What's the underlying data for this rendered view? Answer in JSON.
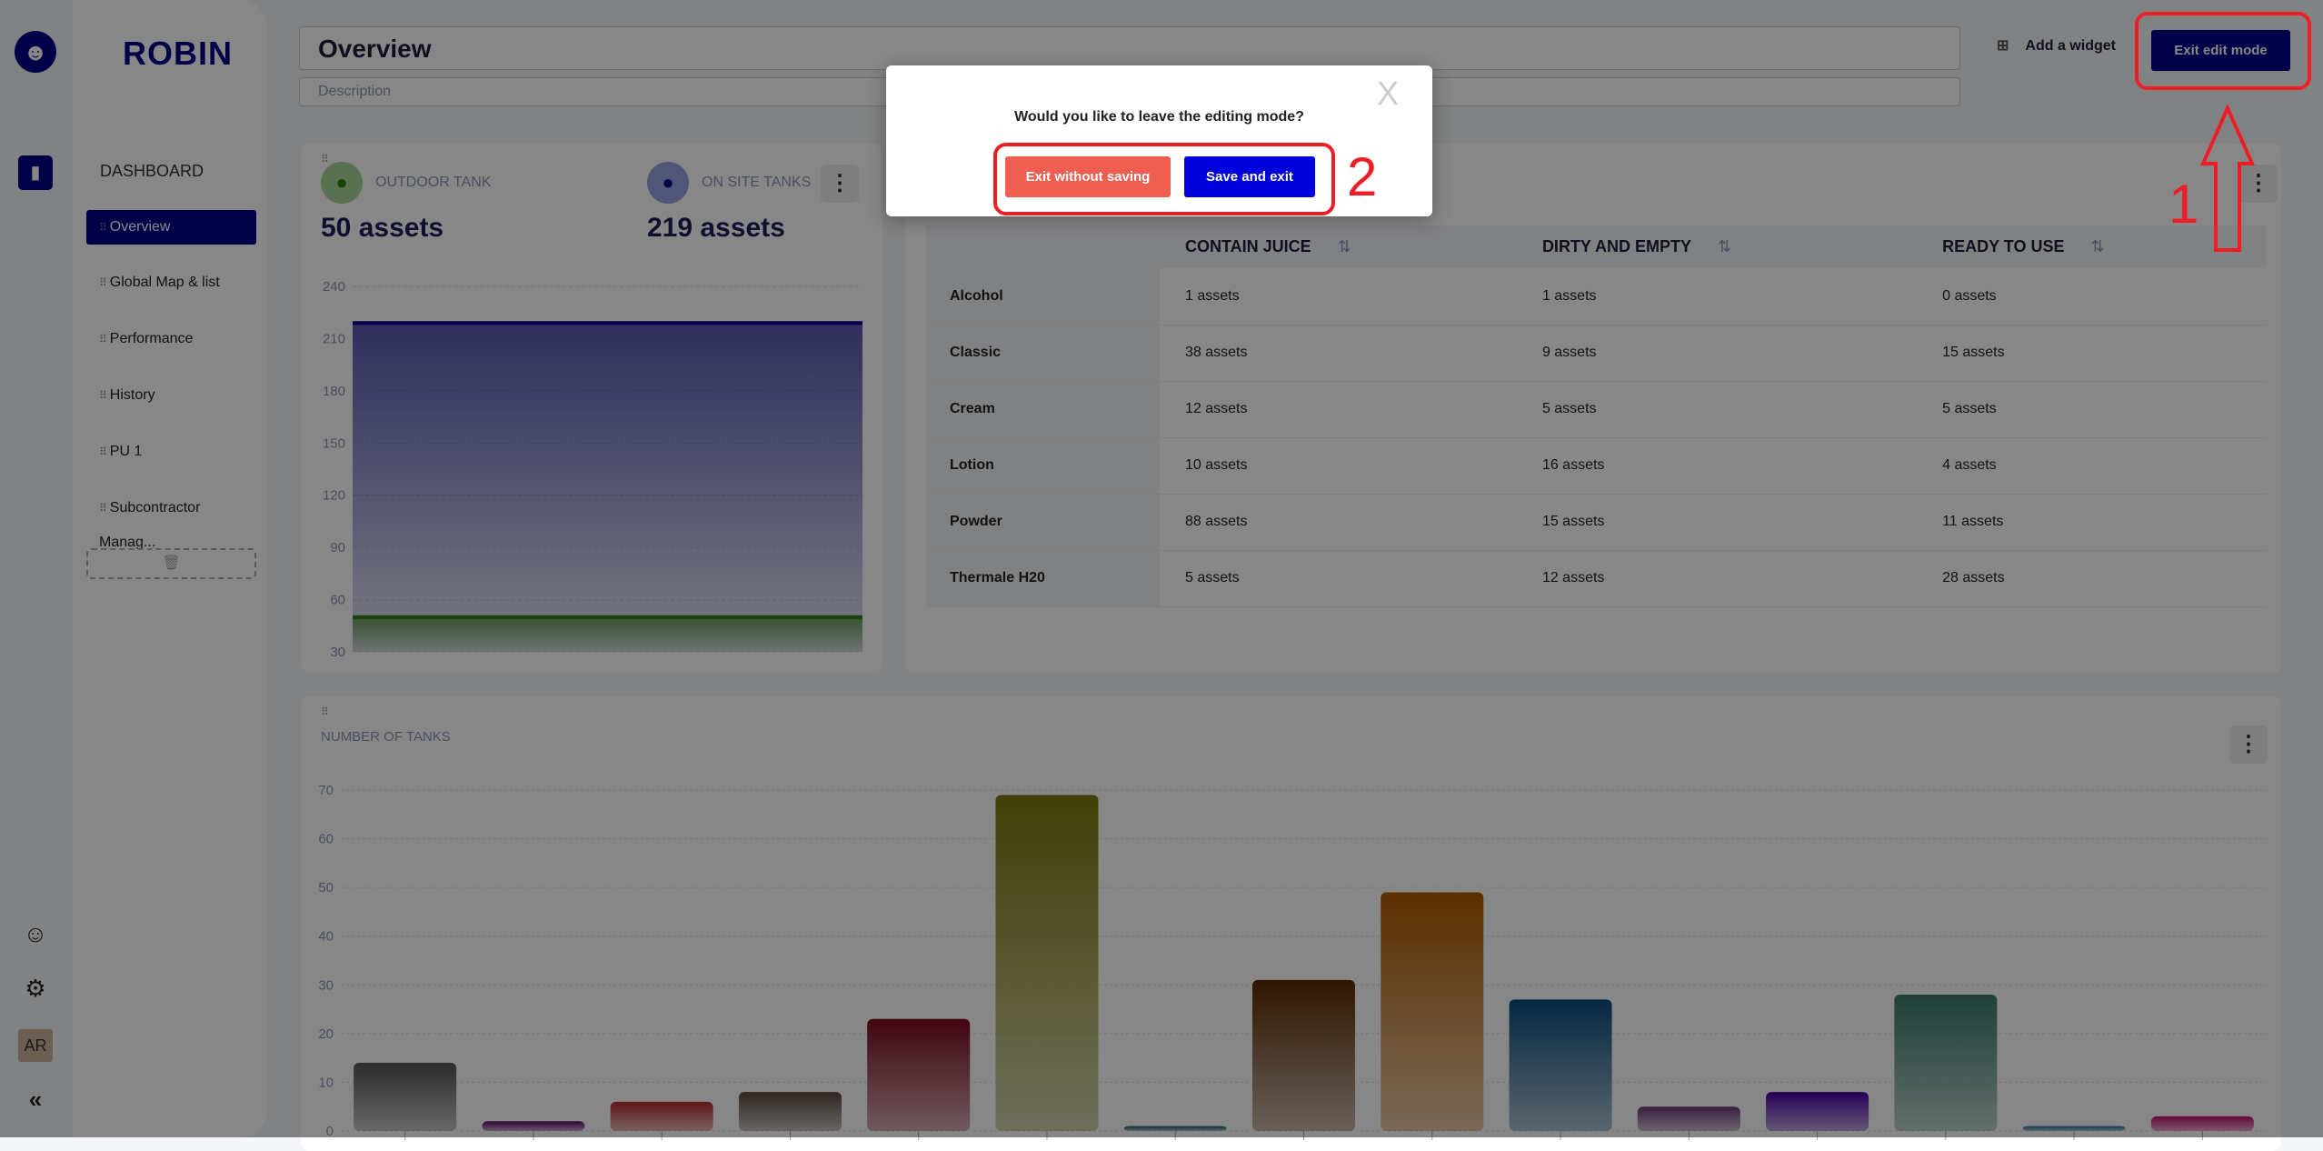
{
  "app": {
    "brand": "ROBIN",
    "logo_icon": "robin-bird-icon"
  },
  "rail": {
    "icons": [
      "folder-icon",
      "support-icon",
      "gear-icon"
    ],
    "avatar": "AR",
    "collapse": "«"
  },
  "sidebar": {
    "section": "DASHBOARD",
    "items": [
      {
        "label": "Overview",
        "active": true
      },
      {
        "label": "Global Map & list"
      },
      {
        "label": "Performance"
      },
      {
        "label": "History"
      },
      {
        "label": "PU 1"
      },
      {
        "label": "Subcontractor Manag..."
      }
    ],
    "trash_icon": "trash-icon"
  },
  "header": {
    "title": "Overview",
    "description_placeholder": "Description",
    "add_widget": "Add a widget",
    "exit_edit": "Exit edit mode"
  },
  "kpis": [
    {
      "label": "OUTDOOR TANK",
      "value": "50 assets",
      "color": "#2e7d0f"
    },
    {
      "label": "ON SITE TANKS",
      "value": "219 assets",
      "color": "#00008a"
    }
  ],
  "table": {
    "columns": [
      "",
      "CONTAIN JUICE",
      "DIRTY AND EMPTY",
      "READY TO USE"
    ],
    "rows": [
      [
        "Alcohol",
        "1 assets",
        "1 assets",
        "0 assets"
      ],
      [
        "Classic",
        "38 assets",
        "9 assets",
        "15 assets"
      ],
      [
        "Cream",
        "12 assets",
        "5 assets",
        "5 assets"
      ],
      [
        "Lotion",
        "10 assets",
        "16 assets",
        "4 assets"
      ],
      [
        "Powder",
        "88 assets",
        "15 assets",
        "11 assets"
      ],
      [
        "Thermale H20",
        "5 assets",
        "12 assets",
        "28 assets"
      ]
    ]
  },
  "chart_data": [
    {
      "type": "area",
      "ylim": [
        30,
        240
      ],
      "yticks": [
        "240",
        "210",
        "180",
        "150",
        "120",
        "90",
        "60",
        "30"
      ],
      "series": [
        {
          "value": 219,
          "color": "#00008a"
        },
        {
          "value": 50,
          "color": "#2e7d0f"
        }
      ],
      "grid": true
    },
    {
      "type": "bar",
      "title": "NUMBER OF TANKS",
      "ylim": [
        0,
        70
      ],
      "yticks": [
        "0",
        "10",
        "20",
        "30",
        "40",
        "50",
        "60",
        "70"
      ],
      "values": [
        14,
        2,
        6,
        8,
        23,
        69,
        1,
        31,
        49,
        27,
        5,
        8,
        28,
        1,
        3
      ],
      "colors": [
        "#555555",
        "#5a0a6a",
        "#b02a2a",
        "#5a4a40",
        "#7a0a1e",
        "#7a7a10",
        "#1a5a6a",
        "#5a2a00",
        "#b05a00",
        "#0a4a7a",
        "#6a3a7a",
        "#4a00a0",
        "#3a7a6a",
        "#1a6aa0",
        "#c0106a"
      ],
      "grid": true
    }
  ],
  "modal": {
    "question": "Would you like to leave the editing mode?",
    "exit_without_saving": "Exit without saving",
    "save_and_exit": "Save and exit",
    "close": "X"
  },
  "annotations": {
    "step1": "1",
    "step2": "2",
    "color": "#ee1c25"
  }
}
